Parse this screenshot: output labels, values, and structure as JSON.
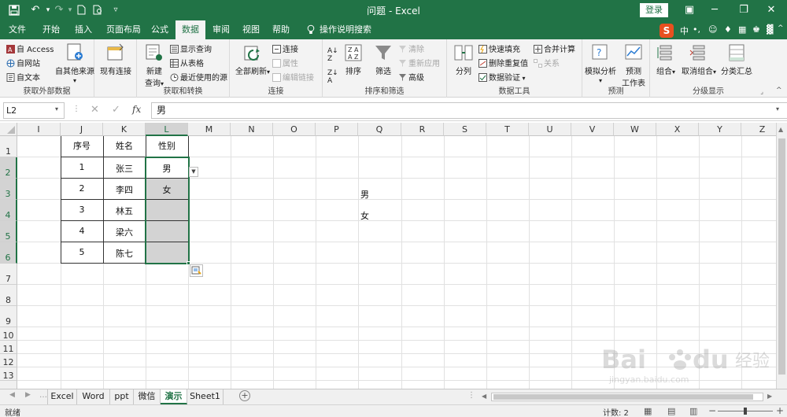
{
  "title_bar": {
    "title": "问题 - Excel",
    "login": "登录"
  },
  "tabs": [
    "文件",
    "开始",
    "插入",
    "页面布局",
    "公式",
    "数据",
    "审阅",
    "视图",
    "帮助",
    "操作说明搜索"
  ],
  "active_tab": "数据",
  "sogou_toolbar": {
    "lang": "中"
  },
  "ribbon": {
    "get_external": {
      "label": "获取外部数据",
      "items": [
        "自 Access",
        "自网站",
        "自文本"
      ],
      "other_sources": "自其他来源",
      "existing": "现有连接"
    },
    "transform": {
      "label": "获取和转换",
      "new_query": [
        "新建",
        "查询"
      ],
      "items": [
        "显示查询",
        "从表格",
        "最近使用的源"
      ]
    },
    "connections": {
      "label": "连接",
      "refresh_all": "全部刷新",
      "items": [
        "连接",
        "属性",
        "编辑链接"
      ]
    },
    "sort_filter": {
      "label": "排序和筛选",
      "sort": "排序",
      "filter": "筛选",
      "items": [
        "清除",
        "重新应用",
        "高级"
      ]
    },
    "data_tools": {
      "label": "数据工具",
      "split": "分列",
      "items": [
        "快速填充",
        "删除重复值",
        "数据验证"
      ],
      "items2": [
        "合并计算",
        "关系"
      ]
    },
    "forecast": {
      "label": "预测",
      "what_if": "模拟分析",
      "sheet": [
        "预测",
        "工作表"
      ]
    },
    "outline": {
      "label": "分级显示",
      "items": [
        "组合",
        "取消组合",
        "分类汇总"
      ]
    }
  },
  "formula_bar": {
    "name_box": "L2",
    "fx": "fx",
    "value": "男"
  },
  "grid": {
    "columns": [
      "I",
      "J",
      "K",
      "L",
      "M",
      "N",
      "O",
      "P",
      "Q",
      "R",
      "S",
      "T",
      "U",
      "V",
      "W",
      "X",
      "Y",
      "Z"
    ],
    "rows": [
      "1",
      "2",
      "3",
      "4",
      "5",
      "6",
      "7",
      "8",
      "9",
      "10",
      "11",
      "12",
      "13"
    ],
    "table_headers": [
      "序号",
      "姓名",
      "性别"
    ],
    "table_rows": [
      [
        "1",
        "张三",
        "男"
      ],
      [
        "2",
        "李四",
        "女"
      ],
      [
        "3",
        "林五",
        ""
      ],
      [
        "4",
        "梁六",
        ""
      ],
      [
        "5",
        "陈七",
        ""
      ]
    ],
    "side_list": [
      "男",
      "女"
    ]
  },
  "sheets": [
    "Excel",
    "Word",
    "ppt",
    "微信",
    "演示",
    "Sheet1"
  ],
  "active_sheet": "演示",
  "status_bar": {
    "mode": "就绪",
    "count": "计数: 2"
  },
  "colors": {
    "accent": "#217346",
    "selected_fill": "#d3d3d3"
  }
}
